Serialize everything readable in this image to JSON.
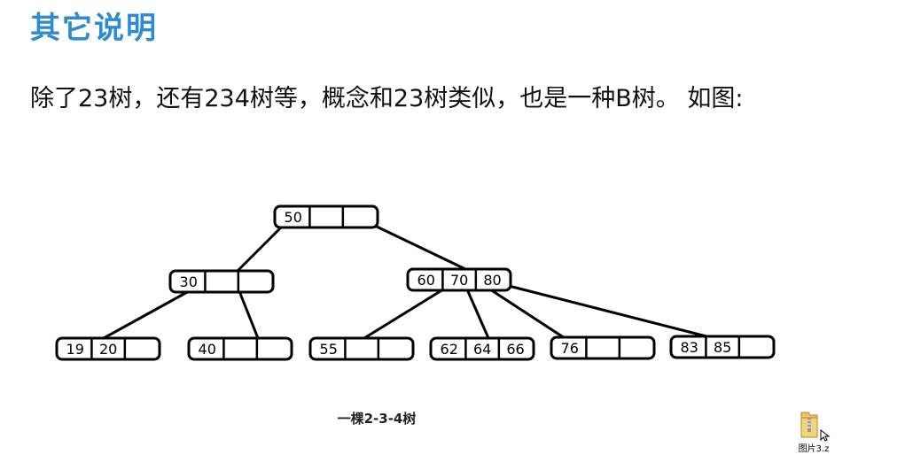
{
  "heading": "其它说明",
  "paragraph": "除了23树，还有234树等，概念和23树类似，也是一种B树。 如图:",
  "diagram": {
    "caption": "一棵2-3-4树",
    "root": {
      "keys": [
        "50",
        "",
        ""
      ]
    },
    "level1": [
      {
        "keys": [
          "30",
          "",
          ""
        ]
      },
      {
        "keys": [
          "60",
          "70",
          "80"
        ]
      }
    ],
    "leaves": [
      {
        "keys": [
          "19",
          "20",
          ""
        ]
      },
      {
        "keys": [
          "40",
          "",
          ""
        ]
      },
      {
        "keys": [
          "55",
          "",
          ""
        ]
      },
      {
        "keys": [
          "62",
          "64",
          "66"
        ]
      },
      {
        "keys": [
          "76",
          "",
          ""
        ]
      },
      {
        "keys": [
          "83",
          "85",
          ""
        ]
      }
    ]
  },
  "attachment": {
    "icon": "zip-folder-icon",
    "label": "图片3.z"
  }
}
